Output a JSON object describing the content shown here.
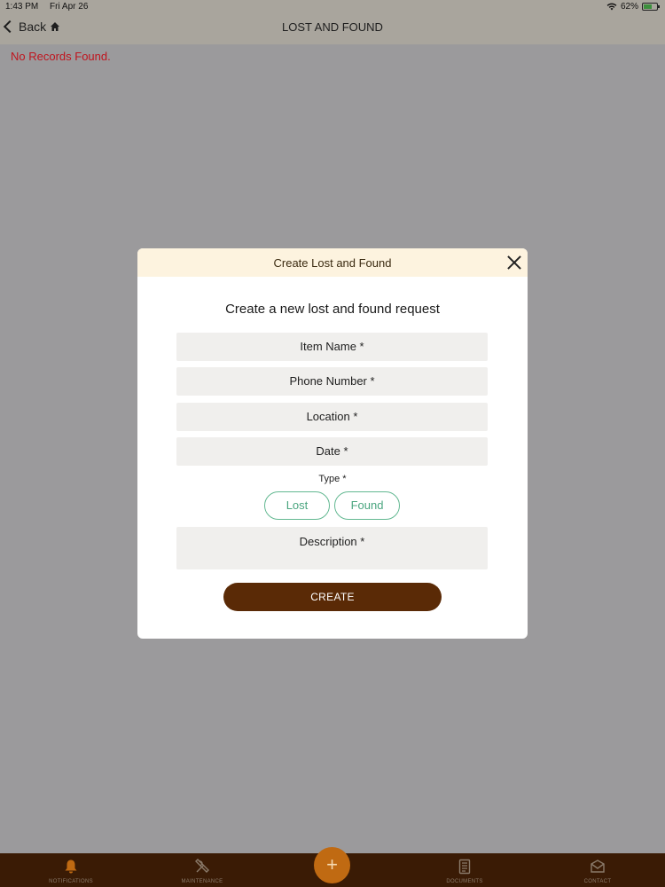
{
  "status_bar": {
    "time": "1:43 PM",
    "date": "Fri Apr 26",
    "battery": "62%"
  },
  "nav": {
    "back_label": "Back",
    "title": "LOST AND FOUND"
  },
  "content": {
    "empty_message": "No Records Found."
  },
  "modal": {
    "title": "Create Lost and Found",
    "subtitle": "Create a new lost and found request",
    "fields": {
      "item_name": "Item Name *",
      "phone_number": "Phone Number *",
      "location": "Location *",
      "date": "Date *"
    },
    "type_label": "Type *",
    "type_options": [
      "Lost",
      "Found"
    ],
    "description_placeholder": "Description *",
    "create_label": "CREATE"
  },
  "tabbar": {
    "notifications": "NOTIFICATIONS",
    "maintenance": "MAINTENANCE",
    "add": "+",
    "documents": "DOCUMENTS",
    "contact": "CONTACT"
  },
  "colors": {
    "accent": "#5a2a06",
    "fab": "#c06a12",
    "error": "#c0141e",
    "pill": "#62b891"
  }
}
